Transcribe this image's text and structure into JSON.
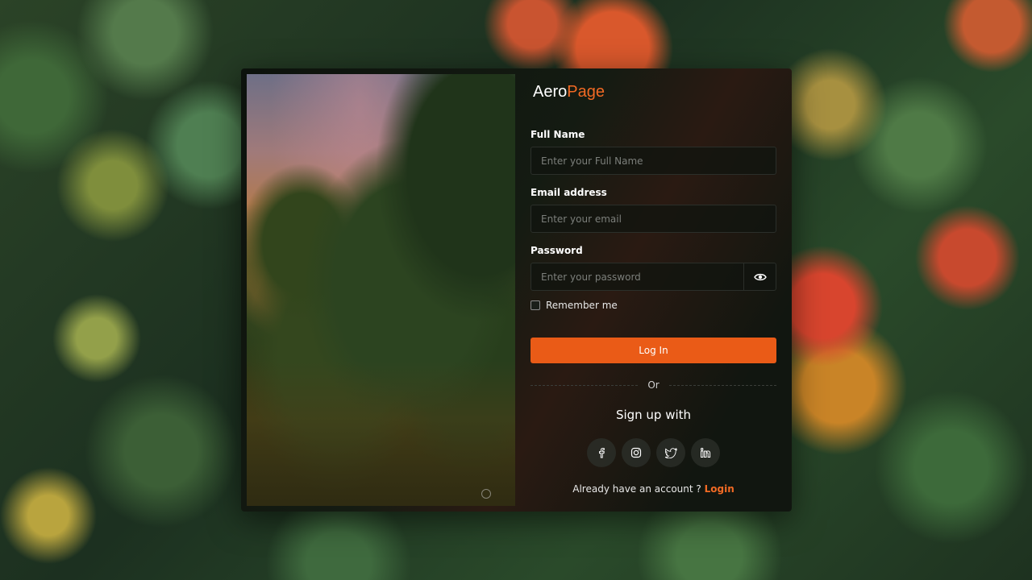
{
  "brand": {
    "part1": "Aero",
    "part2": "Page"
  },
  "form": {
    "full_name_label": "Full Name",
    "full_name_placeholder": "Enter your Full Name",
    "full_name_value": "",
    "email_label": "Email address",
    "email_placeholder": "Enter your email",
    "email_value": "",
    "password_label": "Password",
    "password_placeholder": "Enter your password",
    "password_value": "",
    "remember_label": "Remember me",
    "remember_checked": false,
    "login_button": "Log In",
    "divider_text": "Or",
    "signup_title": "Sign up with",
    "footer_prefix": "Already have an account ? ",
    "footer_link": "Login"
  },
  "socials": [
    {
      "icon": "facebook-icon"
    },
    {
      "icon": "instagram-icon"
    },
    {
      "icon": "twitter-icon"
    },
    {
      "icon": "linkedin-icon"
    }
  ],
  "colors": {
    "accent": "#ea5b17",
    "brand_accent": "#f26a24",
    "card_bg": "#0f150f"
  }
}
